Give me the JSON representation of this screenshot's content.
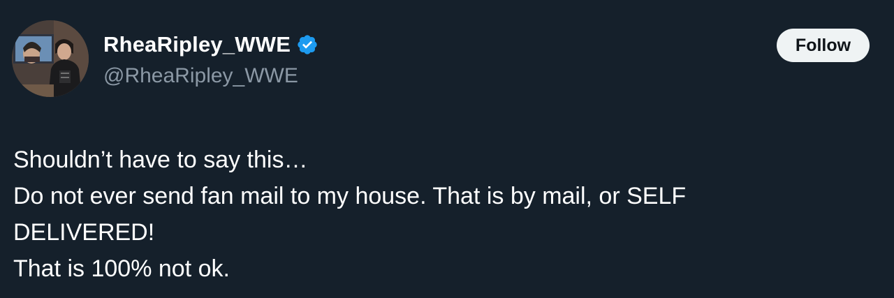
{
  "tweet": {
    "author": {
      "display_name": "RheaRipley_WWE",
      "handle": "@RheaRipley_WWE",
      "verified": true,
      "verified_color": "#1d9bf0"
    },
    "follow_label": "Follow",
    "text_lines": [
      "Shouldn’t have to say this…",
      "Do not ever send fan mail to my house. That is by mail, or SELF",
      "DELIVERED!",
      "That is 100% not ok."
    ]
  },
  "colors": {
    "background": "#15202b",
    "text_primary": "#ffffff",
    "text_secondary": "#8b98a5",
    "button_bg": "#eff3f4",
    "button_text": "#0f1419"
  },
  "icons": {
    "avatar": "profile-photo",
    "verified": "verified-badge-icon"
  }
}
